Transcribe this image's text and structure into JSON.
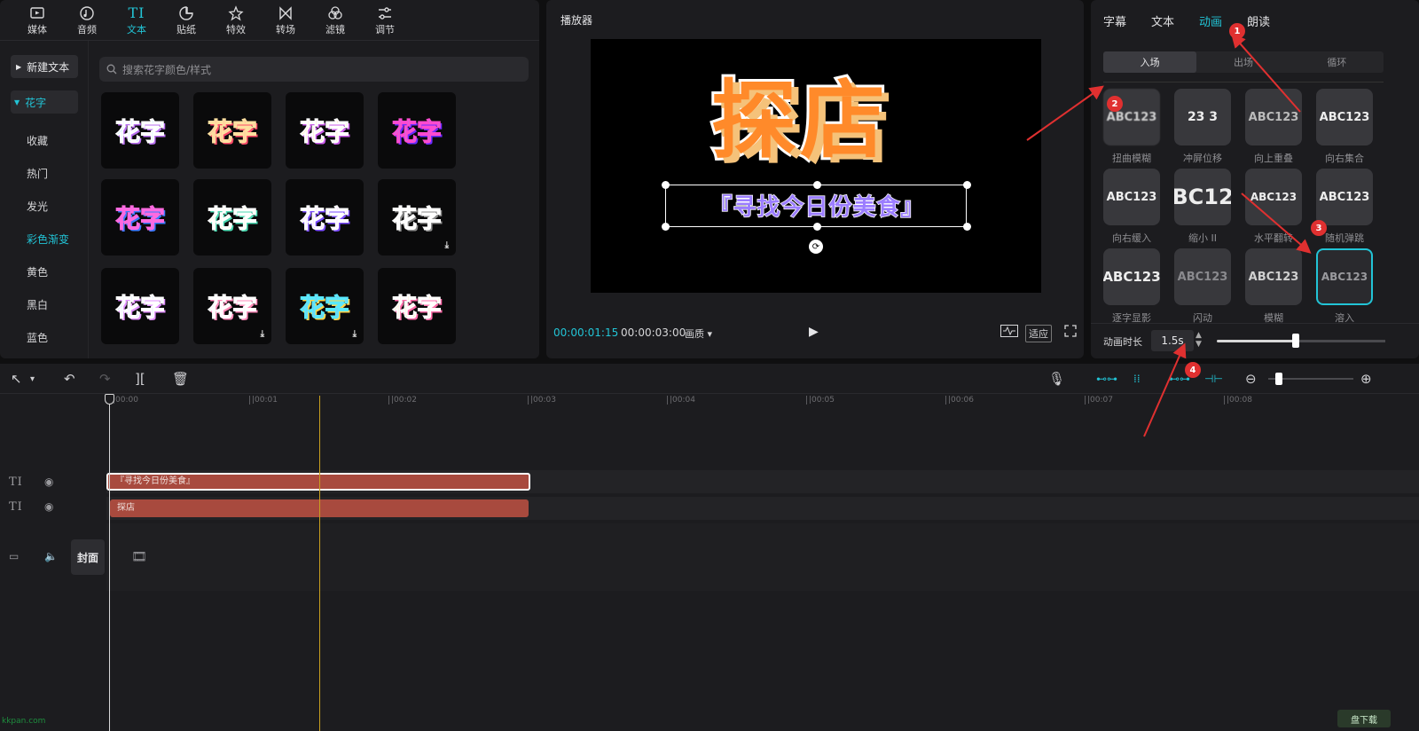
{
  "categories": [
    {
      "label": "媒体",
      "icon": "media-icon"
    },
    {
      "label": "音频",
      "icon": "audio-icon"
    },
    {
      "label": "文本",
      "icon": "text-icon",
      "glyph": "TI"
    },
    {
      "label": "贴纸",
      "icon": "sticker-icon"
    },
    {
      "label": "特效",
      "icon": "effects-icon"
    },
    {
      "label": "转场",
      "icon": "transition-icon"
    },
    {
      "label": "滤镜",
      "icon": "filter-icon"
    },
    {
      "label": "调节",
      "icon": "adjust-icon"
    }
  ],
  "library": {
    "new_text": "新建文本",
    "section": "花字",
    "items": [
      "收藏",
      "热门",
      "发光",
      "彩色渐变",
      "黄色",
      "黑白",
      "蓝色"
    ],
    "search_placeholder": "搜索花字颜色/样式",
    "tile_text": "花字",
    "tile_download": "⤓"
  },
  "player": {
    "title": "播放器",
    "preview_main": "探店",
    "preview_sub": "『寻找今日份美食』",
    "current_time": "00:00:01:15",
    "total_time": "00:00:03:00",
    "quality": "画质",
    "fit_label": "适应"
  },
  "properties": {
    "tabs": [
      "字幕",
      "文本",
      "动画",
      "朗读"
    ],
    "subtabs": [
      "入场",
      "出场",
      "循环"
    ],
    "animations": [
      {
        "label": "扭曲模糊",
        "sample": "ABC123"
      },
      {
        "label": "冲屏位移",
        "sample": "23 3"
      },
      {
        "label": "向上重叠",
        "sample": "ABC123"
      },
      {
        "label": "向右集合",
        "sample": "ABC123"
      },
      {
        "label": "向右缓入",
        "sample": "ABC123"
      },
      {
        "label": "缩小 II",
        "sample": "BC12"
      },
      {
        "label": "水平翻转",
        "sample": "ABC123"
      },
      {
        "label": "随机弹跳",
        "sample": "ABC123"
      },
      {
        "label": "逐字显影",
        "sample": "ABC123"
      },
      {
        "label": "闪动",
        "sample": "ABC123"
      },
      {
        "label": "模糊",
        "sample": "ABC123"
      },
      {
        "label": "溶入",
        "sample": "ABC123"
      }
    ],
    "duration_label": "动画时长",
    "duration_value": "1.5s",
    "duration_fraction": 0.47
  },
  "timeline": {
    "ruler": [
      "00:00",
      "00:01",
      "00:02",
      "00:03",
      "00:04",
      "00:05",
      "00:06",
      "00:07",
      "00:08"
    ],
    "clip1": "『寻找今日份美食』",
    "clip2": "探店",
    "cover": "封面",
    "track_icon": "TI"
  },
  "annotations": [
    "1",
    "2",
    "3",
    "4"
  ],
  "watermark": "kkpan.com",
  "watermark2": "盘下载",
  "colors": {
    "accent": "#22c4d6",
    "clip": "#a84a3e",
    "annotation": "#e03030",
    "playline": "#c9a020"
  }
}
